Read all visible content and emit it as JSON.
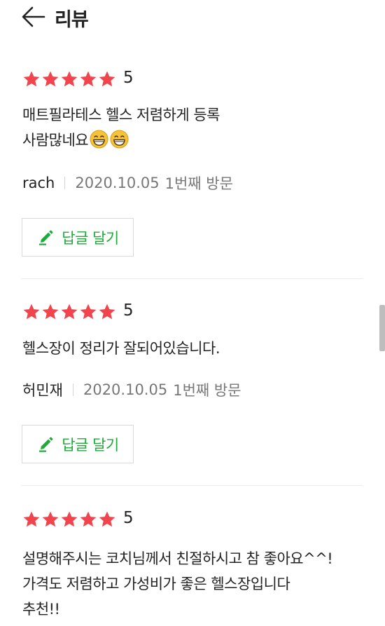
{
  "header": {
    "title": "리뷰",
    "back_icon": "arrow-left-icon"
  },
  "colors": {
    "star": "#f2444c",
    "accent_green": "#1fab3a",
    "meta_gray": "#777777"
  },
  "reviews": [
    {
      "rating": 5,
      "score": "5",
      "lines": [
        "매트필라테스 헬스 저렴하게 등록",
        "사람많네요"
      ],
      "emoji": "grinning-face-emoji",
      "author": "rach",
      "date": "2020.10.05",
      "visit": "1번째 방문",
      "reply_label": "답글 달기"
    },
    {
      "rating": 5,
      "score": "5",
      "lines": [
        "헬스장이 정리가 잘되어있습니다."
      ],
      "author": "허민재",
      "date": "2020.10.05",
      "visit": "1번째 방문",
      "reply_label": "답글 달기"
    },
    {
      "rating": 5,
      "score": "5",
      "lines": [
        "설명해주시는 코치님께서 친절하시고 참 좋아요^^!",
        "가격도 저렴하고 가성비가 좋은 헬스장입니다",
        "추천!!"
      ]
    }
  ]
}
